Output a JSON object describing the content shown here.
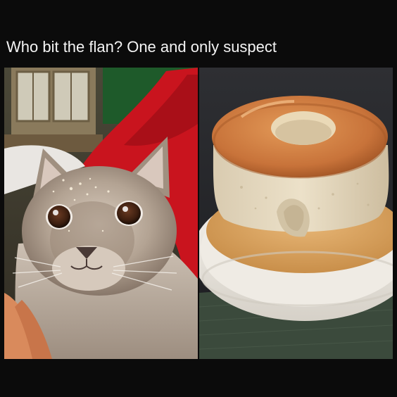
{
  "meme": {
    "caption": "Who bit the flan? One and only suspect"
  },
  "colors": {
    "background": "#0b0b0b",
    "caption_text": "#f4f4f4",
    "caramel": "#c8733a",
    "custard": "#e6d9bf",
    "plate": "#ece8e0",
    "blanket": "#c9141e",
    "cat_fur": "#b9aa9a"
  },
  "images": {
    "left": {
      "subject": "cat-with-crumbs-on-face"
    },
    "right": {
      "subject": "flan-with-bite-mark"
    }
  }
}
